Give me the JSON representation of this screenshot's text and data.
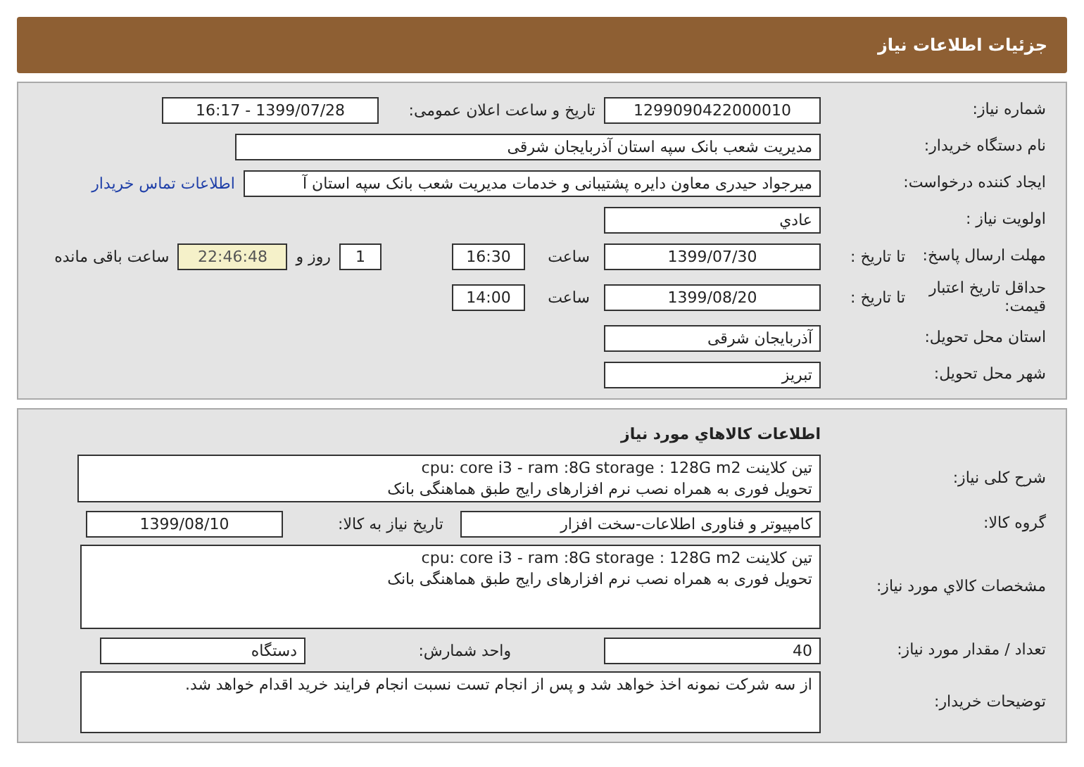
{
  "header": {
    "title": "جزئیات اطلاعات نیاز"
  },
  "need_info": {
    "number_label": "شماره نیاز:",
    "number": "1299090422000010",
    "announce_label": "تاریخ و ساعت اعلان عمومی:",
    "announce_datetime": "1399/07/28 - 16:17",
    "buyer_org_label": "نام دستگاه خریدار:",
    "buyer_org": "مدیریت شعب بانک سپه استان آذربایجان شرقی",
    "requester_label": "ایجاد کننده درخواست:",
    "requester": "میرجواد حیدری معاون دایره پشتیبانی و خدمات مدیریت شعب بانک سپه استان آ",
    "contact_link": "اطلاعات تماس خریدار",
    "priority_label": "اولویت نیاز :",
    "priority": "عادي",
    "deadline": {
      "label": "مهلت ارسال پاسخ:",
      "to_date_label": "تا تاریخ :",
      "date": "1399/07/30",
      "time_label": "ساعت",
      "time": "16:30",
      "days": "1",
      "days_label": "روز و",
      "remaining": "22:46:48",
      "remaining_label": "ساعت باقی مانده"
    },
    "validity": {
      "label": "حداقل تاریخ اعتبار قیمت:",
      "to_date_label": "تا تاریخ :",
      "date": "1399/08/20",
      "time_label": "ساعت",
      "time": "14:00"
    },
    "province_label": "استان محل تحویل:",
    "province": "آذربایجان شرقی",
    "city_label": "شهر محل تحویل:",
    "city": "تبریز"
  },
  "goods": {
    "title": "اطلاعات کالاهاي مورد نیاز",
    "description_label": "شرح کلی نیاز:",
    "description": [
      "تین کلاینت cpu: core i3 - ram :8G storage : 128G m2",
      "تحویل فوری به همراه نصب نرم افزارهای رایج طبق هماهنگی بانک"
    ],
    "group_label": "گروه کالا:",
    "group": "کامپیوتر و فناوری اطلاعات-سخت افزار",
    "need_date_label": "تاریخ نیاز به کالا:",
    "need_date": "1399/08/10",
    "spec_label": "مشخصات کالاي مورد نیاز:",
    "spec": [
      "تین کلاینت cpu: core i3 - ram :8G storage : 128G m2",
      "تحویل فوری به همراه نصب نرم افزارهای رایج طبق هماهنگی بانک"
    ],
    "qty_label": "تعداد / مقدار مورد نیاز:",
    "qty": "40",
    "unit_label": "واحد شمارش:",
    "unit": "دستگاه",
    "notes_label": "توضیحات خریدار:",
    "notes": "از سه شرکت نمونه اخذ خواهد شد و پس از انجام تست نسبت انجام فرایند خرید اقدام خواهد شد."
  }
}
